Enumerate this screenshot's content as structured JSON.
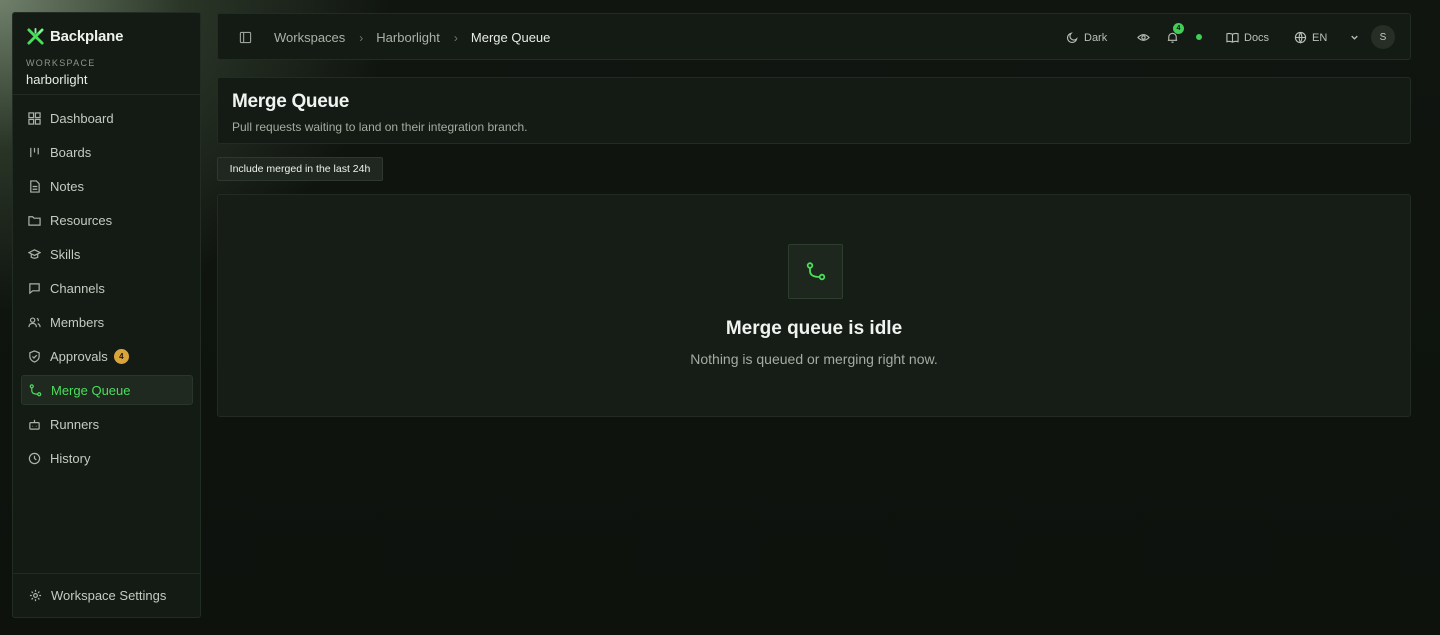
{
  "sidebar": {
    "brand": "Backplane",
    "workspace_label": "WORKSPACE",
    "workspace_name": "harborlight",
    "items": [
      {
        "label": "Dashboard",
        "icon": "dashboard-icon"
      },
      {
        "label": "Boards",
        "icon": "boards-icon"
      },
      {
        "label": "Notes",
        "icon": "notes-icon"
      },
      {
        "label": "Resources",
        "icon": "folder-icon"
      },
      {
        "label": "Skills",
        "icon": "graduation-cap-icon"
      },
      {
        "label": "Channels",
        "icon": "message-square-icon"
      },
      {
        "label": "Members",
        "icon": "users-icon"
      },
      {
        "label": "Approvals",
        "icon": "shield-check-icon",
        "badge": "4"
      },
      {
        "label": "Merge Queue",
        "icon": "git-merge-icon",
        "active": true
      },
      {
        "label": "Runners",
        "icon": "bot-icon"
      },
      {
        "label": "History",
        "icon": "clock-icon"
      }
    ],
    "settings_label": "Workspace Settings"
  },
  "topbar": {
    "breadcrumbs": [
      "Workspaces",
      "Harborlight",
      "Merge Queue"
    ],
    "theme_label": "Dark",
    "notification_count": "4",
    "docs_label": "Docs",
    "language": "EN",
    "avatar_initial": "S"
  },
  "header": {
    "title": "Merge Queue",
    "subtitle": "Pull requests waiting to land on their integration branch."
  },
  "filter": {
    "label": "Include merged in the last 24h"
  },
  "empty_state": {
    "icon": "git-merge-icon",
    "title": "Merge queue is idle",
    "message": "Nothing is queued or merging right now."
  },
  "colors": {
    "accent": "#4ade5c",
    "badge": "#d9a53a",
    "background": "#0d120d",
    "panel": "#141a14"
  }
}
